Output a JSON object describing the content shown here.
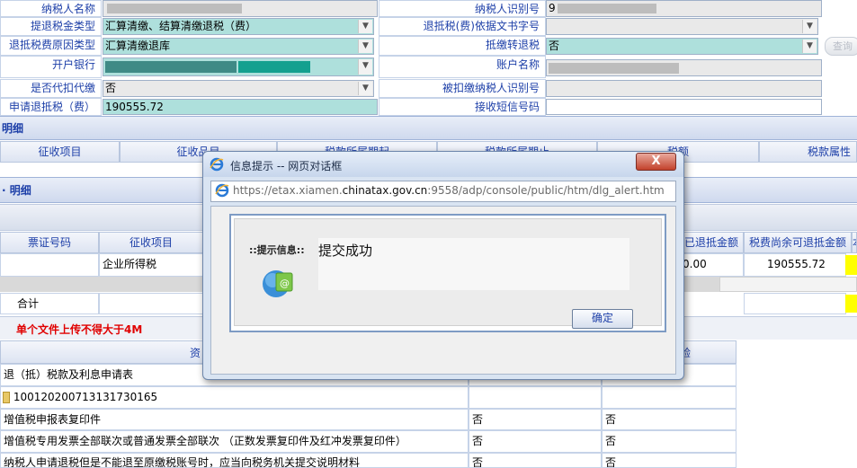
{
  "form": {
    "taxpayer_name_label": "纳税人名称",
    "taxpayer_id_label": "纳税人识别号",
    "taxpayer_id_value": "9",
    "refund_type_label": "提退税金类型",
    "refund_type_value": "汇算清缴、结算清缴退税（费）",
    "refund_doc_label": "退抵税(费)依据文书字号",
    "reason_label": "退抵税费原因类型",
    "reason_value": "汇算清缴退库",
    "transfer_label": "抵缴转退税",
    "transfer_value": "否",
    "bank_label": "开户银行",
    "account_name_label": "账户名称",
    "withholding_label": "是否代扣代缴",
    "withholding_value": "否",
    "withheld_id_label": "被扣缴纳税人识别号",
    "amount_label": "申请退抵税（费）额",
    "amount_value": "190555.72",
    "sms_label": "接收短信号码",
    "side_button": "查询"
  },
  "section1": {
    "title": "明细",
    "cols": [
      "征收项目",
      "征收品目",
      "税款所属期起",
      "税款所属期止",
      "税额",
      "税款属性"
    ]
  },
  "section2": {
    "title": "明细",
    "cols": [
      "票证号码",
      "征收项目",
      "已退抵金额",
      "税费尚余可退抵金额",
      "本"
    ],
    "row": {
      "item": "企业所得税",
      "refunded": "0.00",
      "remaining": "190555.72"
    },
    "total_label": "合计"
  },
  "upload": {
    "warning": "单个文件上传不得大于4M",
    "col_left": "资",
    "col_right": "验",
    "rows": [
      {
        "text": "退（抵）税款及利息申请表",
        "a": "",
        "b": ""
      },
      {
        "text": "10012020071313173016​5",
        "a": "",
        "b": ""
      },
      {
        "text": "增值税申报表复印件",
        "a": "否",
        "b": "否"
      },
      {
        "text": "增值税专用发票全部联次或普通发票全部联次 （正数发票复印件及红冲发票复印件）",
        "a": "否",
        "b": "否"
      },
      {
        "text": "纳税人申请退税但是不能退至原缴税账号时，应当向税务机关提交说明材料",
        "a": "否",
        "b": "否"
      }
    ]
  },
  "dialog": {
    "title": "信息提示 -- 网页对话框",
    "close": "X",
    "url_prefix": "https://etax.xiamen.",
    "url_domain": "chinatax.gov.cn",
    "url_suffix": ":9558/adp/console/public/htm/dlg_alert.htm",
    "info_label": "::提示信息::",
    "message": "提交成功",
    "ok": "确定"
  },
  "colors": {
    "teal": "#aee0dc",
    "accent": "#1d3fa8",
    "warning": "#e00000",
    "highlight": "#ffff00"
  }
}
